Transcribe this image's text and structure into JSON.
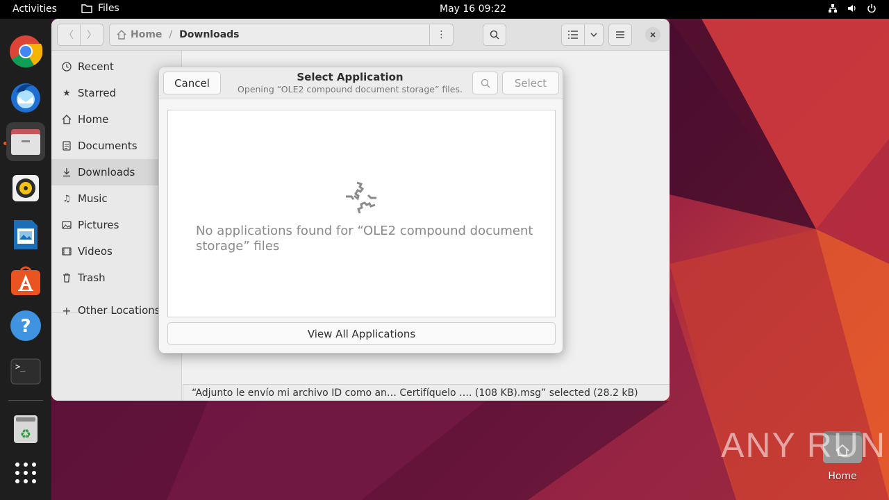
{
  "topbar": {
    "activities": "Activities",
    "app_name": "Files",
    "clock": "May 16  09:22"
  },
  "dock": {
    "items": [
      "chrome-icon",
      "thunderbird-icon",
      "files-icon",
      "rhythmbox-icon",
      "libreoffice-writer-icon",
      "app-center-icon",
      "help-icon",
      "terminal-icon",
      "trash-icon",
      "show-apps-icon"
    ]
  },
  "files": {
    "path_home": "Home",
    "path_separator": "/",
    "path_current": "Downloads",
    "sidebar": [
      {
        "label": "Recent",
        "icon": "clock-icon"
      },
      {
        "label": "Starred",
        "icon": "star-icon"
      },
      {
        "label": "Home",
        "icon": "home-icon"
      },
      {
        "label": "Documents",
        "icon": "document-icon"
      },
      {
        "label": "Downloads",
        "icon": "download-icon"
      },
      {
        "label": "Music",
        "icon": "music-icon"
      },
      {
        "label": "Pictures",
        "icon": "picture-icon"
      },
      {
        "label": "Videos",
        "icon": "video-icon"
      },
      {
        "label": "Trash",
        "icon": "trash-icon"
      },
      {
        "label": "Other Locations",
        "icon": "plus-icon"
      }
    ],
    "status": "“Adjunto le envío mi archivo ID como an… Certifíquelo …. (108 KB).msg” selected (28.2 kB)"
  },
  "dialog": {
    "cancel_label": "Cancel",
    "title": "Select Application",
    "subtitle": "Opening “OLE2 compound document storage” files.",
    "select_label": "Select",
    "empty_message": "No applications found for “OLE2 compound document storage” files",
    "view_all_label": "View All Applications"
  },
  "desktop": {
    "home_label": "Home",
    "watermark": "ANY RUN"
  }
}
